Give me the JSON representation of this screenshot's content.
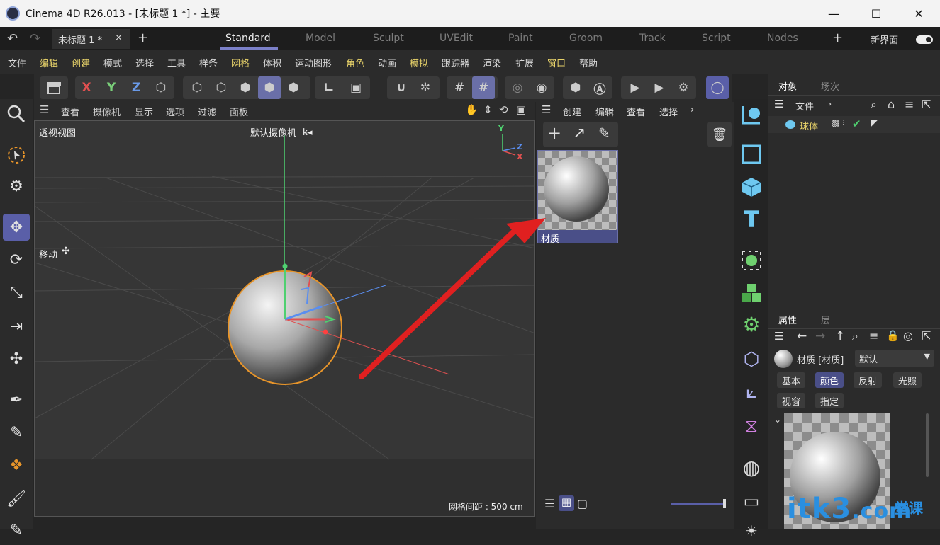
{
  "window": {
    "title": "Cinema 4D R26.013 - [未标题 1 *] - 主要",
    "minimize": "—",
    "maximize": "☐",
    "close": "✕"
  },
  "tabs": {
    "doc_label": "未标题 1 *",
    "close_glyph": "×",
    "new_glyph": "+",
    "layouts": [
      "Standard",
      "Model",
      "Sculpt",
      "UVEdit",
      "Paint",
      "Groom",
      "Track",
      "Script",
      "Nodes"
    ],
    "active_layout": "Standard",
    "add_layout": "+",
    "new_ui": "新界面"
  },
  "menu": {
    "items": [
      "文件",
      "编辑",
      "创建",
      "模式",
      "选择",
      "工具",
      "样条",
      "网格",
      "体积",
      "运动图形",
      "角色",
      "动画",
      "模拟",
      "跟踪器",
      "渲染",
      "扩展",
      "窗口",
      "帮助"
    ]
  },
  "toolbar": {
    "axes": [
      "X",
      "Y",
      "Z"
    ]
  },
  "viewport": {
    "menu": [
      "查看",
      "摄像机",
      "显示",
      "选项",
      "过滤",
      "面板"
    ],
    "view_name": "透视视图",
    "camera": "默认摄像机",
    "camera_glyph": "ꝃ◂",
    "tool_label": "移动",
    "grid_info": "网格间距 : 500 cm",
    "axis_y": "Y",
    "axis_z": "Z",
    "axis_x": "X"
  },
  "material_manager": {
    "menu": [
      "创建",
      "编辑",
      "查看",
      "选择"
    ],
    "more": "›",
    "material_name": "材质"
  },
  "objects": {
    "tabs": [
      "对象",
      "场次"
    ],
    "menu_file": "文件",
    "more": "›",
    "item": "球体"
  },
  "attributes": {
    "tabs": [
      "属性",
      "层"
    ],
    "title": "材质 [材质]",
    "mode": "默认",
    "channels": [
      "基本",
      "颜色",
      "反射",
      "光照",
      "视窗",
      "指定"
    ],
    "active_channel": "颜色"
  },
  "watermark": {
    "main": "itk3",
    "sub": "堂课",
    "dot": ".com"
  },
  "colors": {
    "accent": "#4a4f88",
    "selection_orange": "#e8952a",
    "arrow_red": "#e02020"
  }
}
